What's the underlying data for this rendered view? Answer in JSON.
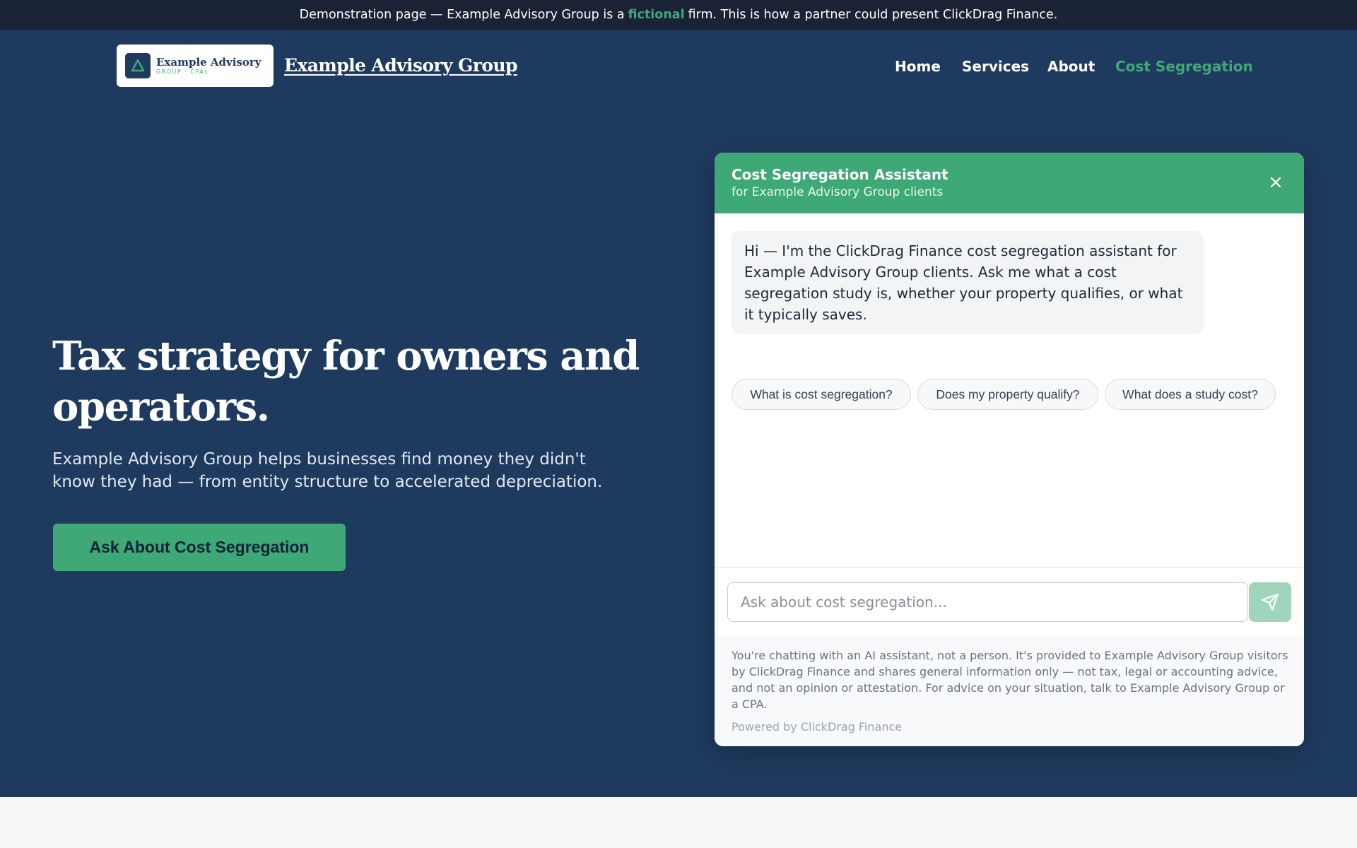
{
  "banner": {
    "before": "Demonstration page — Example Advisory Group is a",
    "highlight": "fictional",
    "after": "firm. This is how a partner could present ClickDrag Finance."
  },
  "header": {
    "logo": {
      "line1": "Example Advisory",
      "line2": "GROUP · CPAs"
    },
    "brand": "Example Advisory Group",
    "nav": [
      {
        "label": "Home"
      },
      {
        "label": "Services"
      },
      {
        "label": "About"
      },
      {
        "label": "Cost Segregation",
        "active": true
      }
    ]
  },
  "hero": {
    "title": "Tax strategy for owners and operators.",
    "lede": "Example Advisory Group helps businesses find money they didn't know they had — from entity structure to accelerated depreciation.",
    "cta": "Ask About Cost Segregation"
  },
  "chat": {
    "title": "Cost Segregation Assistant",
    "subtitle": "for Example Advisory Group clients",
    "greeting": "Hi — I'm the ClickDrag Finance cost segregation assistant for Example Advisory Group clients. Ask me what a cost segregation study is, whether your property qualifies, or what it typically saves.",
    "suggestions": [
      {
        "label": "What is cost segregation?"
      },
      {
        "label": "Does my property qualify?"
      },
      {
        "label": "What does a study cost?"
      }
    ],
    "input_placeholder": "Ask about cost segregation...",
    "disclaimer": "You're chatting with an AI assistant, not a person. It's provided to Example Advisory Group visitors by ClickDrag Finance and shares general information only — not tax, legal or accounting advice, and not an opinion or attestation. For advice on your situation, talk to Example Advisory Group or a CPA.",
    "powered_by": "Powered by ClickDrag Finance"
  },
  "colors": {
    "navy": "#1f3a5f",
    "banner": "#1a2236",
    "accent": "#3ea876",
    "send_disabled": "#9fd6bb"
  }
}
